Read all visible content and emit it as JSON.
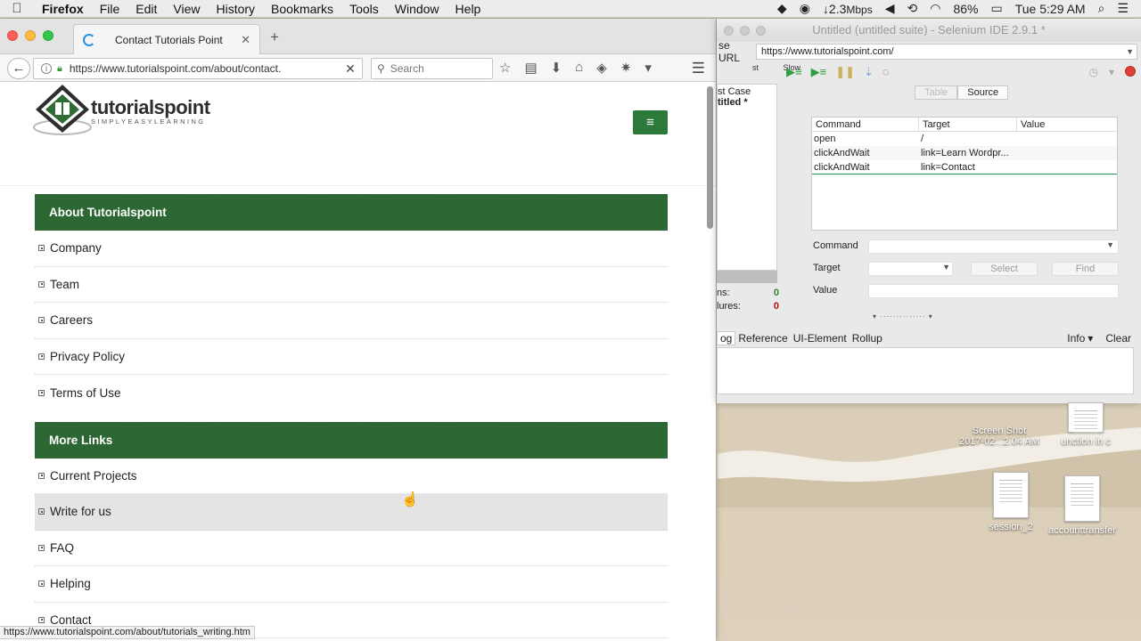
{
  "menubar": {
    "apple": "",
    "items": [
      "Firefox",
      "File",
      "Edit",
      "View",
      "History",
      "Bookmarks",
      "Tools",
      "Window",
      "Help"
    ],
    "network": "↓2.3",
    "network_unit": "Mbps",
    "battery": "86%",
    "clock": "Tue 5:29 AM"
  },
  "browser": {
    "tab_title": "Contact Tutorials Point",
    "url": "https://www.tutorialspoint.com/about/contact.",
    "search_placeholder": "Search",
    "status_url": "https://www.tutorialspoint.com/about/tutorials_writing.htm"
  },
  "site": {
    "brand": "tutorialspoint",
    "tagline": "SIMPLYEASYLEARNING",
    "menu_icon": "≡",
    "sections": [
      {
        "title": "About Tutorialspoint",
        "items": [
          "Company",
          "Team",
          "Careers",
          "Privacy Policy",
          "Terms of Use"
        ]
      },
      {
        "title": "More Links",
        "items": [
          "Current Projects",
          "Write for us",
          "FAQ",
          "Helping",
          "Contact"
        ]
      }
    ]
  },
  "selenium": {
    "title": "Untitled (untitled suite) - Selenium IDE 2.9.1 *",
    "base_url_label": "se URL",
    "base_url": "https://www.tutorialspoint.com/",
    "speed_fast": "st",
    "speed_slow": "Slow",
    "testcase_header": "st Case",
    "testcase_item": "titled *",
    "runs_label": "ns:",
    "runs_value": "0",
    "failures_label": "lures:",
    "failures_value": "0",
    "tab_table": "Table",
    "tab_source": "Source",
    "columns": [
      "Command",
      "Target",
      "Value"
    ],
    "rows": [
      {
        "command": "open",
        "target": "/",
        "value": ""
      },
      {
        "command": "clickAndWait",
        "target": "link=Learn Wordpr...",
        "value": ""
      },
      {
        "command": "clickAndWait",
        "target": "link=Contact",
        "value": ""
      }
    ],
    "command_label": "Command",
    "target_label": "Target",
    "value_label": "Value",
    "select_btn": "Select",
    "find_btn": "Find",
    "log_tabs": [
      "og",
      "Reference",
      "UI-Element",
      "Rollup"
    ],
    "info": "Info",
    "clear": "Clear"
  },
  "desktop": {
    "icons": [
      {
        "label1": "Screen Shot",
        "label2": "2017-02...2.04 AM"
      },
      {
        "label1": "unction in c",
        "label2": ""
      },
      {
        "label1": "session_2",
        "label2": ""
      },
      {
        "label1": "accounttransfer",
        "label2": ""
      }
    ]
  }
}
